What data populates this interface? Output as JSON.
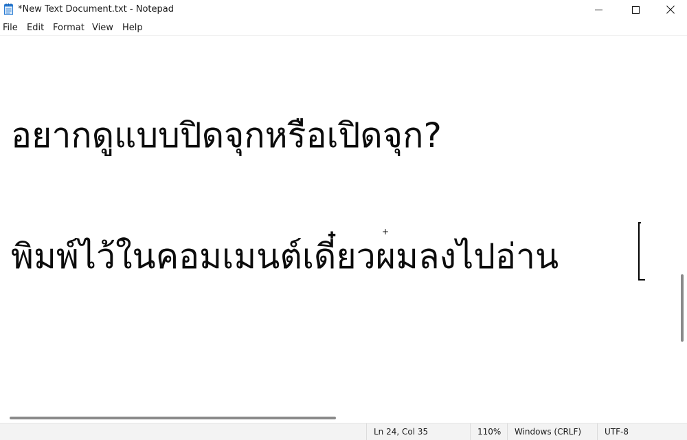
{
  "window": {
    "title": "*New Text Document.txt - Notepad",
    "app_icon": "notepad-icon",
    "controls": {
      "minimize": "minimize-icon",
      "maximize": "maximize-icon",
      "close": "close-icon"
    }
  },
  "menu": {
    "file": "File",
    "edit": "Edit",
    "format": "Format",
    "view": "View",
    "help": "Help"
  },
  "editor": {
    "lines": [
      "อยากดูแบบปิดจุกหรือเปิดจุก?",
      "พิมพ์ไว้ในคอมเมนต์เดี๋ยวผมลงไปอ่าน"
    ],
    "mouse_cursor_icon": "crosshair-cursor-icon"
  },
  "status": {
    "position": "Ln 24, Col 35",
    "zoom": "110%",
    "line_ending": "Windows (CRLF)",
    "encoding": "UTF-8"
  },
  "colors": {
    "background": "#ffffff",
    "text": "#0c0c0c",
    "statusbar": "#f3f3f3",
    "scroll_thumb": "#8a8a8a",
    "icon_blue": "#2b7cd3"
  }
}
